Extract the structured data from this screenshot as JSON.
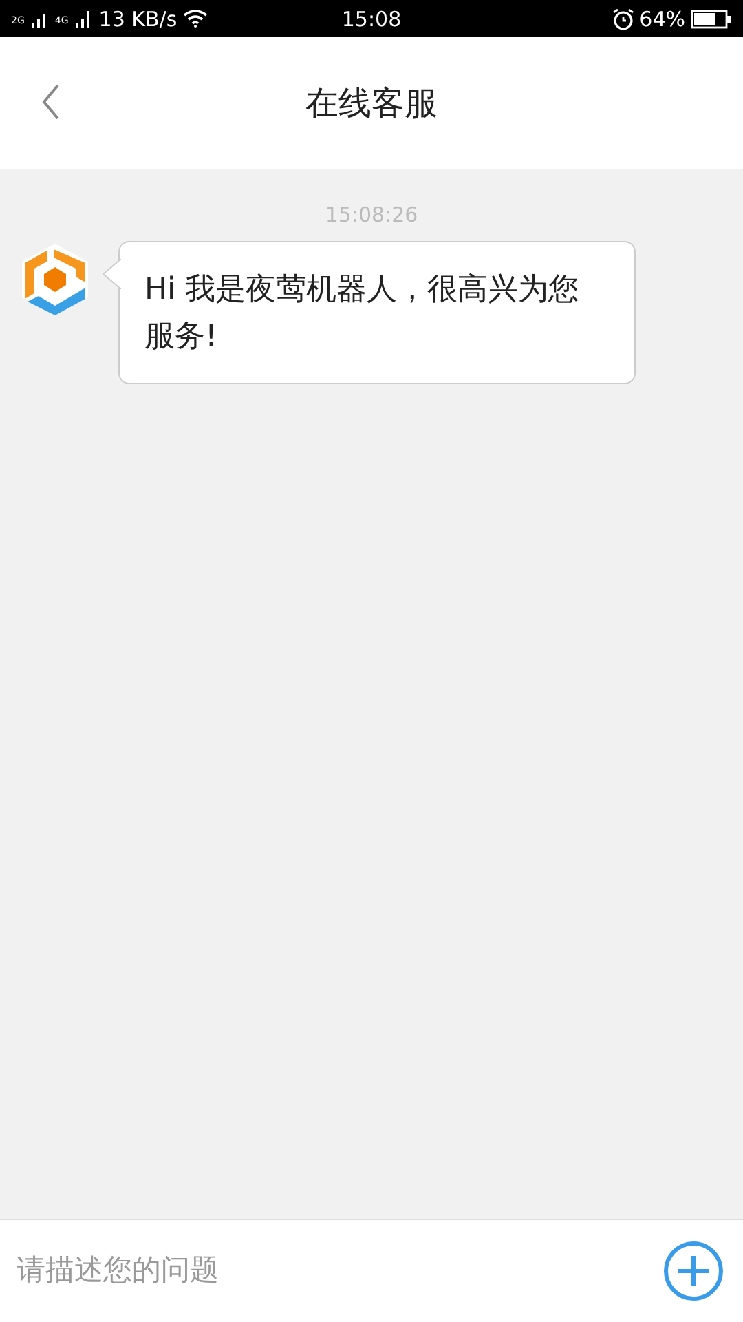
{
  "status_bar": {
    "sim_1": "2G",
    "sim_2": "4G",
    "speed": "13 KB/s",
    "time": "15:08",
    "battery": "64%"
  },
  "header": {
    "title": "在线客服"
  },
  "messages": [
    {
      "kind": "time",
      "text": "15:08:26"
    },
    {
      "kind": "incoming",
      "text": "Hi 我是夜莺机器人，很高兴为您服务!"
    }
  ],
  "composer": {
    "placeholder": "请描述您的问题"
  }
}
